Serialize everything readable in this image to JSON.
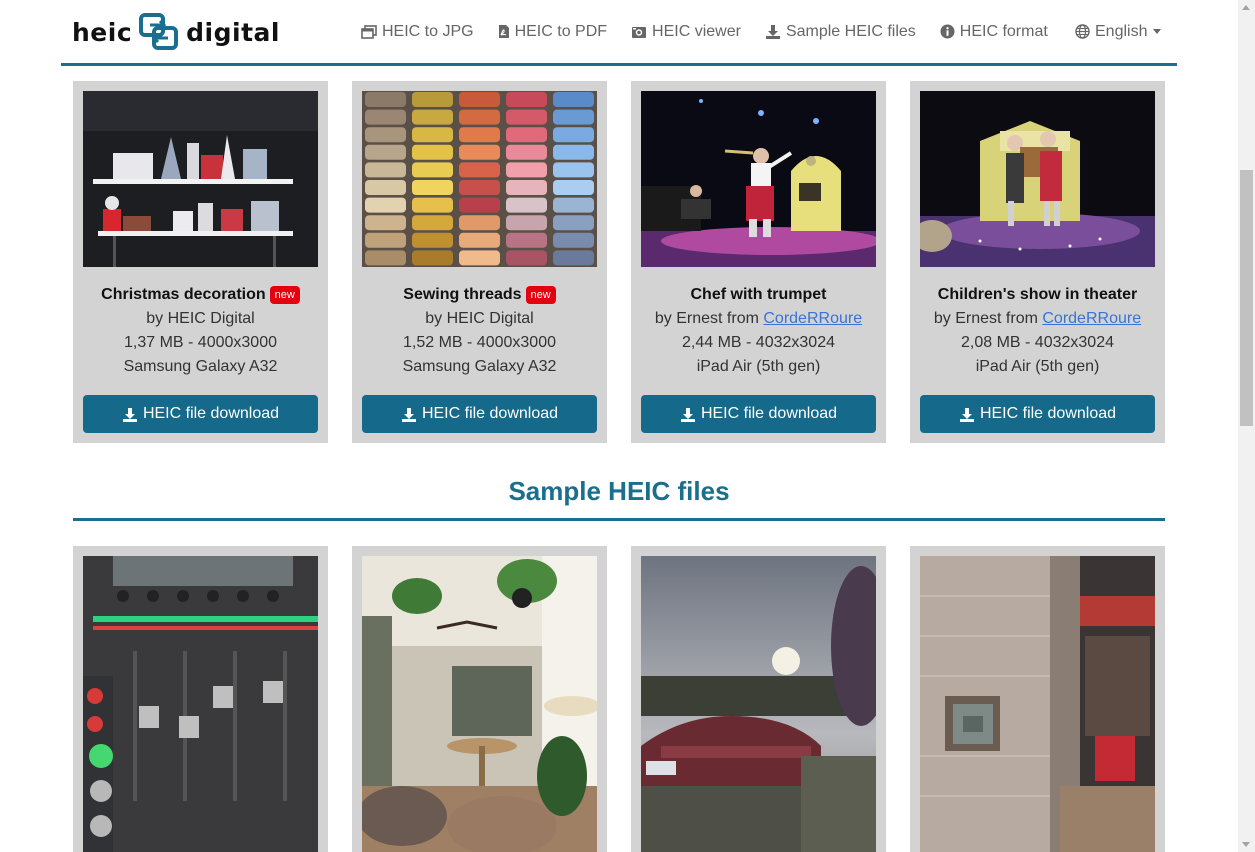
{
  "brand": {
    "left": "heic",
    "right": "digital"
  },
  "nav": {
    "items": [
      {
        "label": "HEIC to JPG",
        "icon": "windows-icon"
      },
      {
        "label": "HEIC to PDF",
        "icon": "pdf-file-icon"
      },
      {
        "label": "HEIC viewer",
        "icon": "camera-icon"
      },
      {
        "label": "Sample HEIC files",
        "icon": "download-icon"
      },
      {
        "label": "HEIC format",
        "icon": "info-icon"
      }
    ],
    "language": "English"
  },
  "featured": [
    {
      "title": "Christmas decoration",
      "badge": "new",
      "author": "by HEIC Digital",
      "author_link": "",
      "size": "1,37 MB - 4000x3000",
      "device": "Samsung Galaxy A32",
      "button": "HEIC file download"
    },
    {
      "title": "Sewing threads",
      "badge": "new",
      "author": "by HEIC Digital",
      "author_link": "",
      "size": "1,52 MB - 4000x3000",
      "device": "Samsung Galaxy A32",
      "button": "HEIC file download"
    },
    {
      "title": "Chef with trumpet",
      "badge": "",
      "author": "by Ernest from ",
      "author_link": "CordeRRoure",
      "size": "2,44 MB - 4032x3024",
      "device": "iPad Air (5th gen)",
      "button": "HEIC file download"
    },
    {
      "title": "Children's show in theater",
      "badge": "",
      "author": "by Ernest from ",
      "author_link": "CordeRRoure",
      "size": "2,08 MB - 4032x3024",
      "device": "iPad Air (5th gen)",
      "button": "HEIC file download"
    }
  ],
  "section": {
    "title": "Sample HEIC files"
  },
  "colors": {
    "accent": "#1a6e8e",
    "button": "#15698a",
    "card": "#d3d3d3",
    "badge": "#e3000f",
    "link": "#3a73d8"
  }
}
